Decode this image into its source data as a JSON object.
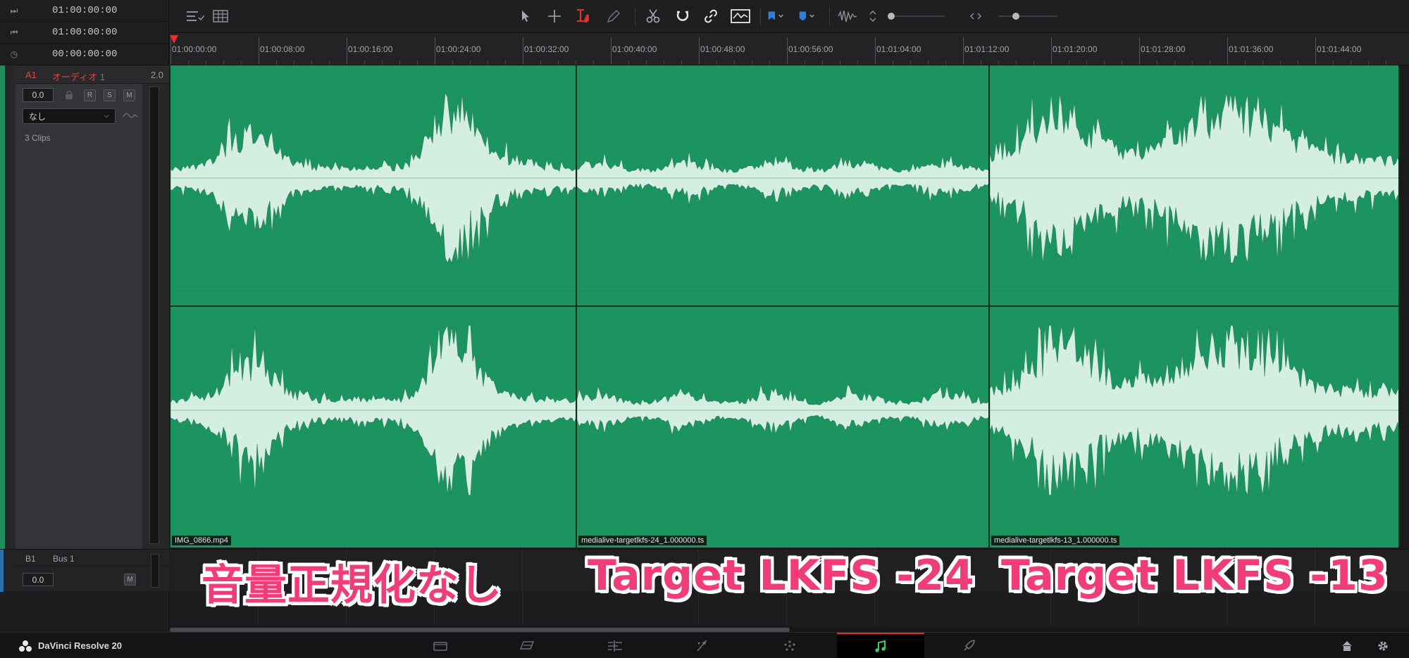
{
  "timecodes": [
    {
      "icon": "skip-next-icon",
      "value": "01:00:00:00"
    },
    {
      "icon": "skip-back-icon",
      "value": "01:00:00:00"
    },
    {
      "icon": "clock-icon",
      "value": "00:00:00:00"
    }
  ],
  "audio_track": {
    "id": "A1",
    "name": "オーディオ 1",
    "format": "2.0",
    "volume": "0.0",
    "buttons": [
      "R",
      "S",
      "M"
    ],
    "effect_select": "なし",
    "clip_count": "3 Clips"
  },
  "bus_track": {
    "id": "B1",
    "name": "Bus 1",
    "volume": "0.0",
    "mute": "M"
  },
  "ruler": {
    "labels": [
      "01:00:00:00",
      "01:00:08:00",
      "01:00:16:00",
      "01:00:24:00",
      "01:00:32:00",
      "01:00:40:00",
      "01:00:48:00",
      "01:00:56:00",
      "01:01:04:00",
      "01:01:12:00",
      "01:01:20:00",
      "01:01:28:00",
      "01:01:36:00",
      "01:01:44:00"
    ]
  },
  "clips": [
    {
      "name": "IMG_0866.mp4"
    },
    {
      "name": "medialive-targetlkfs-24_1.000000.ts"
    },
    {
      "name": "medialive-targetlkfs-13_1.000000.ts"
    }
  ],
  "captions": [
    "音量正規化なし",
    "Target LKFS -24",
    "Target LKFS -13"
  ],
  "app": {
    "name": "DaVinci Resolve 20"
  },
  "colors": {
    "clip_green": "#1b9460",
    "waveform": "#d4efe2",
    "playhead": "#e2312d",
    "caption_pink": "#f03c78",
    "track_name_red": "#d64a4a"
  },
  "page_tabs": [
    "media-icon",
    "cut-icon",
    "edit-icon",
    "fusion-icon",
    "color-icon",
    "fairlight-icon",
    "deliver-icon"
  ],
  "active_page": "fairlight-icon"
}
